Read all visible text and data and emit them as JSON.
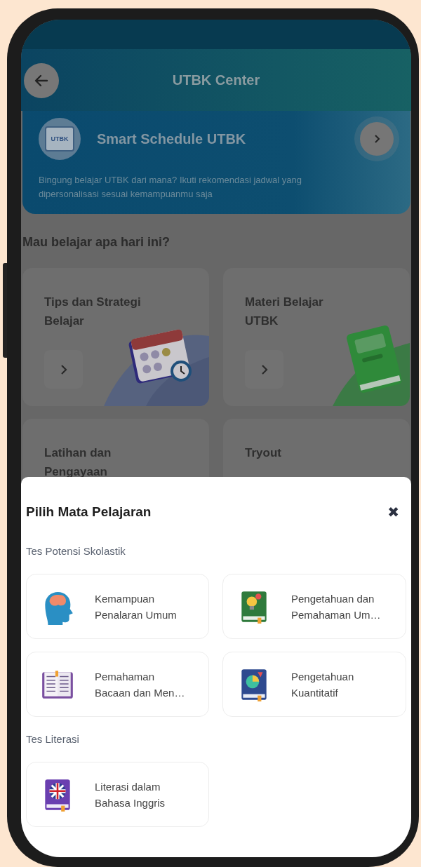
{
  "header": {
    "title": "UTBK Center"
  },
  "schedule_banner": {
    "title": "Smart Schedule UTBK",
    "icon_label": "UTBK",
    "description": "Bingung belajar UTBK dari mana? Ikuti rekomendasi jadwal yang dipersonalisasi sesuai kemampuanmu saja"
  },
  "section_title": "Mau belajar apa hari ini?",
  "menu_cards": [
    {
      "title": "Tips dan Strategi\nBelajar"
    },
    {
      "title": "Materi Belajar\nUTBK"
    },
    {
      "title": "Latihan dan\nPengayaan"
    },
    {
      "title": "Tryout"
    }
  ],
  "sheet": {
    "title": "Pilih Mata Pelajaran",
    "close": "✖",
    "groups": [
      {
        "title": "Tes Potensi Skolastik",
        "subjects": [
          {
            "label": "Kemampuan\nPenalaran Umum"
          },
          {
            "label": "Pengetahuan dan\nPemahaman Um…"
          },
          {
            "label": "Pemahaman\nBacaan dan Men…"
          },
          {
            "label": "Pengetahuan\nKuantitatif"
          }
        ]
      },
      {
        "title": "Tes Literasi",
        "subjects": [
          {
            "label": "Literasi dalam\nBahasa Inggris"
          }
        ]
      }
    ]
  }
}
